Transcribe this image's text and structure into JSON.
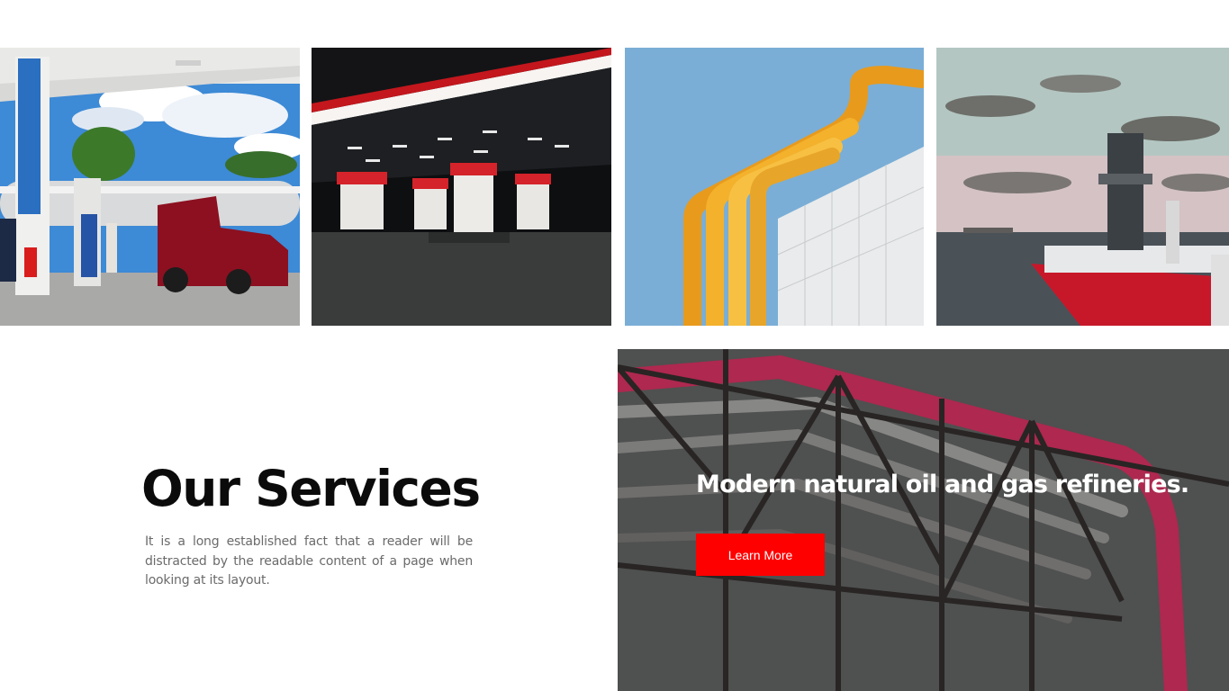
{
  "gallery": {
    "images": [
      {
        "name": "gas-station-daytime-photo"
      },
      {
        "name": "gas-station-night-photo"
      },
      {
        "name": "yellow-pipes-photo"
      },
      {
        "name": "offshore-vessel-photo"
      }
    ]
  },
  "services": {
    "title": "Our Services",
    "description": "It is a long established fact that a reader will be distracted by the readable content of a page when looking at its layout."
  },
  "feature": {
    "heading": "Modern natural oil and gas refineries.",
    "button_label": "Learn More",
    "accent_color": "#ff0000"
  }
}
